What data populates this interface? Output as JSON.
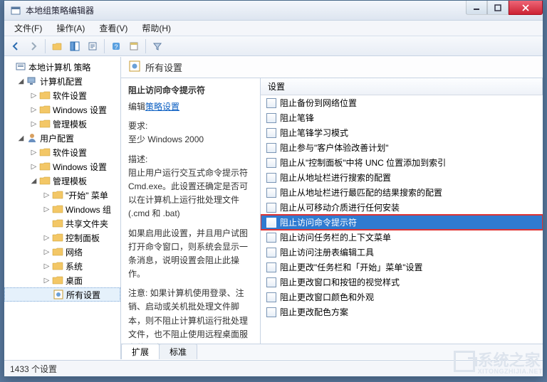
{
  "window": {
    "title": "本地组策略编辑器"
  },
  "menu": {
    "file": "文件(F)",
    "action": "操作(A)",
    "view": "查看(V)",
    "help": "帮助(H)"
  },
  "tree": {
    "root": "本地计算机 策略",
    "computer": "计算机配置",
    "user": "用户配置",
    "soft": "软件设置",
    "winset": "Windows 设置",
    "admintpl": "管理模板",
    "startmenu": "\"开始\" 菜单",
    "wincomp": "Windows 组",
    "shared": "共享文件夹",
    "ctrlpanel": "控制面板",
    "network": "网络",
    "system": "系统",
    "desktop": "桌面",
    "allsettings": "所有设置"
  },
  "header": {
    "title": "所有设置"
  },
  "desc": {
    "title": "阻止访问命令提示符",
    "editlabel": "编辑",
    "editlink": "策略设置",
    "req_label": "要求:",
    "req_value": "至少 Windows 2000",
    "d_label": "描述:",
    "d1": "阻止用户运行交互式命令提示符 Cmd.exe。此设置还确定是否可以在计算机上运行批处理文件(.cmd 和 .bat)",
    "d2": "如果启用此设置，并且用户试图打开命令窗口，则系统会显示一条消息，说明设置会阻止此操作。",
    "d3": "注意: 如果计算机使用登录、注销、启动或关机批处理文件脚本，则不阻止计算机运行批处理文件，也不阻止使用远程桌面服务的用户"
  },
  "listhead": {
    "col1": "设置"
  },
  "items": [
    "阻止备份到网络位置",
    "阻止笔锋",
    "阻止笔锋学习模式",
    "阻止参与\"客户体验改善计划\"",
    "阻止从\"控制面板\"中将 UNC 位置添加到索引",
    "阻止从地址栏进行搜索的配置",
    "阻止从地址栏进行最匹配的结果搜索的配置",
    "阻止从可移动介质进行任何安装",
    "阻止访问命令提示符",
    "阻止访问任务栏的上下文菜单",
    "阻止访问注册表编辑工具",
    "阻止更改\"任务栏和「开始」菜单\"设置",
    "阻止更改窗口和按钮的视觉样式",
    "阻止更改窗口颜色和外观",
    "阻止更改配色方案"
  ],
  "selected_index": 8,
  "tabs": {
    "ext": "扩展",
    "std": "标准"
  },
  "status": {
    "text": "1433 个设置"
  },
  "watermark": {
    "main": "系统之家",
    "sub": "XITONGZHIJIA.NET"
  }
}
